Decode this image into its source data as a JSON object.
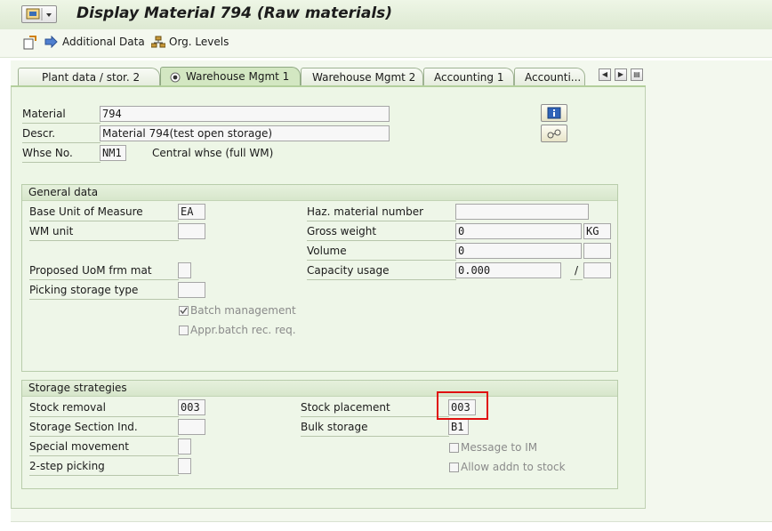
{
  "window": {
    "title": "Display Material 794 (Raw materials)"
  },
  "toolbar": {
    "items": [
      {
        "label": "Additional Data",
        "icon": "arrow-right-icon"
      },
      {
        "label": "Org. Levels",
        "icon": "org-structure-icon"
      }
    ]
  },
  "tabs": [
    {
      "label": "Plant data / stor. 2",
      "active": false
    },
    {
      "label": "Warehouse Mgmt 1",
      "active": true
    },
    {
      "label": "Warehouse Mgmt 2",
      "active": false
    },
    {
      "label": "Accounting 1",
      "active": false
    },
    {
      "label": "Accounti...",
      "active": false
    }
  ],
  "header": {
    "material_label": "Material",
    "material_value": "794",
    "descr_label": "Descr.",
    "descr_value": "Material 794(test open storage)",
    "whse_label": "Whse No.",
    "whse_value": "NM1",
    "whse_text": "Central whse (full WM)"
  },
  "general_data": {
    "title": "General data",
    "base_uom_label": "Base Unit of Measure",
    "base_uom_value": "EA",
    "wm_unit_label": "WM unit",
    "wm_unit_value": "",
    "proposed_uom_label": "Proposed UoM frm mat",
    "proposed_uom_value": "",
    "picking_type_label": "Picking storage type",
    "picking_type_value": "",
    "batch_mgmt_label": "Batch management",
    "batch_mgmt_checked": true,
    "appr_batch_label": "Appr.batch rec. req.",
    "appr_batch_checked": false,
    "haz_label": "Haz. material number",
    "haz_value": "",
    "gross_weight_label": "Gross weight",
    "gross_weight_value": "0",
    "gross_weight_unit": "KG",
    "volume_label": "Volume",
    "volume_value": "0",
    "volume_unit": "",
    "capacity_label": "Capacity usage",
    "capacity_value": "0.000",
    "capacity_sep": "/",
    "capacity_unit": ""
  },
  "storage_strategies": {
    "title": "Storage strategies",
    "stock_removal_label": "Stock removal",
    "stock_removal_value": "003",
    "section_ind_label": "Storage Section Ind.",
    "section_ind_value": "",
    "special_movement_label": "Special movement",
    "special_movement_value": "",
    "two_step_label": "2-step picking",
    "two_step_value": "",
    "stock_placement_label": "Stock placement",
    "stock_placement_value": "003",
    "bulk_storage_label": "Bulk storage",
    "bulk_storage_value": "B1",
    "message_im_label": "Message to IM",
    "message_im_checked": false,
    "allow_addn_label": "Allow addn to stock",
    "allow_addn_checked": false
  },
  "colors": {
    "highlight": "#e01010",
    "panel_bg": "#edf6e6",
    "title_bg": "#dde9d2"
  }
}
